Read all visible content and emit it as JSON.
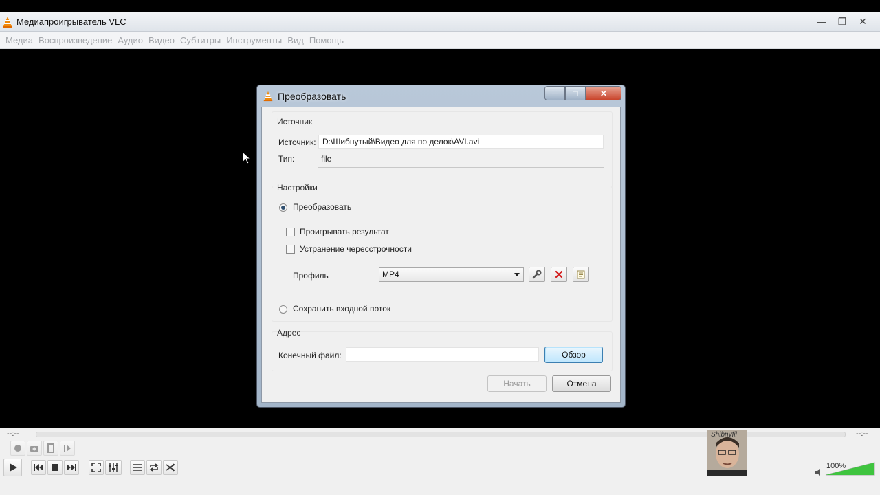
{
  "window": {
    "title": "Медиапроигрыватель VLC"
  },
  "menu": [
    "Медиа",
    "Воспроизведение",
    "Аудио",
    "Видео",
    "Субтитры",
    "Инструменты",
    "Вид",
    "Помощь"
  ],
  "dialog": {
    "title": "Преобразовать",
    "source_group": "Источник",
    "source_label": "Источник:",
    "source_value": "D:\\Шибнутый\\Видео для по делок\\AVI.avi",
    "type_label": "Тип:",
    "type_value": "file",
    "settings_group": "Настройки",
    "convert_radio": "Преобразовать",
    "play_result": "Проигрывать результат",
    "deinterlace": "Устранение чересстрочности",
    "profile_label": "Профиль",
    "profile_value": "MP4",
    "dump_radio": "Сохранить входной поток",
    "dest_group": "Адрес",
    "dest_label": "Конечный файл:",
    "dest_value": "",
    "browse": "Обзор",
    "start": "Начать",
    "cancel": "Отмена"
  },
  "player": {
    "time_left": "--:--",
    "time_right": "--:--",
    "volume": "100%",
    "avatar_text": "Shibnyfil",
    "volume_level": 1.0
  },
  "colors": {
    "accent": "#3c7fb1",
    "volume_green": "#3fc43f"
  },
  "icons": [
    "vlc-cone-icon",
    "minimize-icon",
    "maximize-icon",
    "close-icon",
    "wrench-icon",
    "delete-x-icon",
    "new-profile-icon",
    "record-icon",
    "snapshot-icon",
    "loop-ab-icon",
    "frame-step-icon",
    "play-icon",
    "prev-icon",
    "stop-icon",
    "next-icon",
    "fullscreen-icon",
    "extended-settings-icon",
    "playlist-icon",
    "loop-icon",
    "shuffle-icon",
    "speaker-icon"
  ]
}
